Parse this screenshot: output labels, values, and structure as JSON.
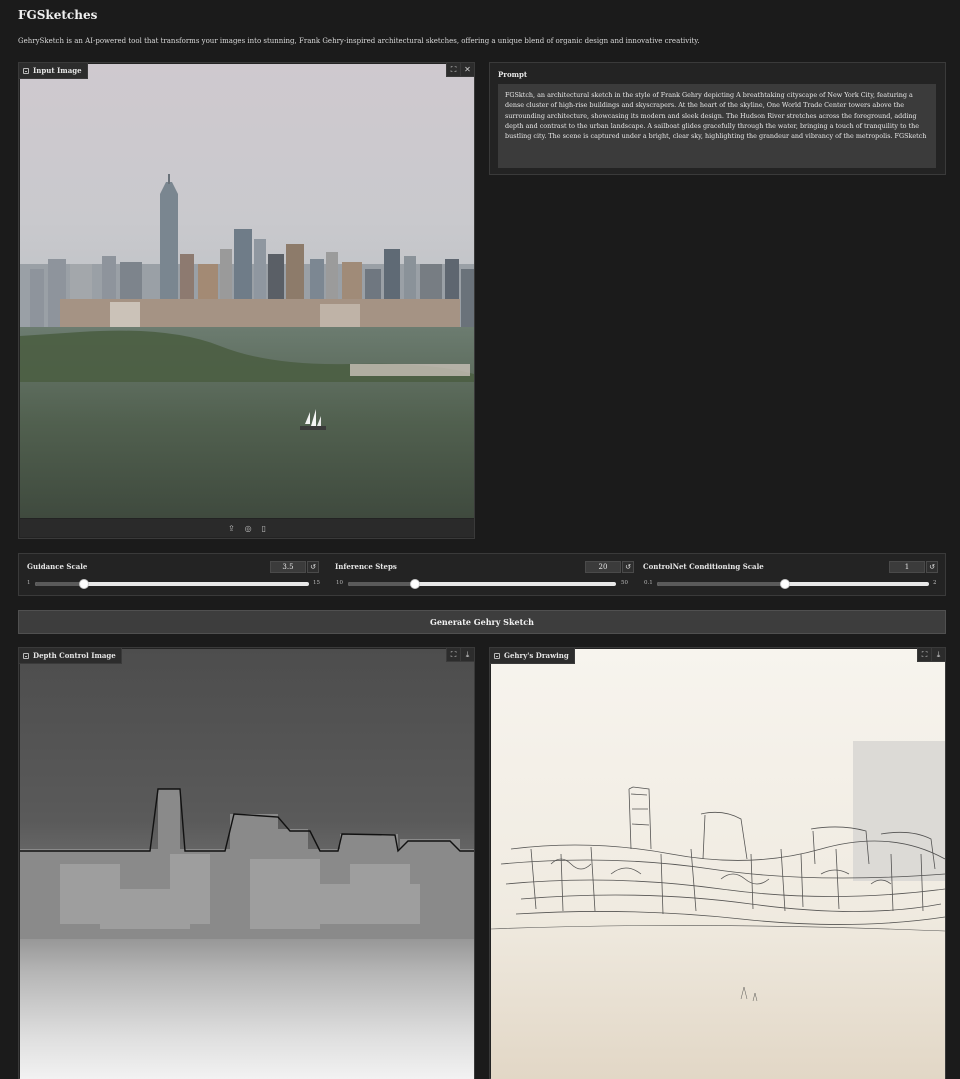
{
  "app": {
    "title": "FGSketches",
    "description": "GehrySketch is an AI-powered tool that transforms your images into stunning, Frank Gehry-inspired architectural sketches, offering a unique blend of organic design and innovative creativity."
  },
  "input_image": {
    "label": "Input Image",
    "icons": [
      "image-icon",
      "fullscreen-icon",
      "close-icon",
      "upload-icon",
      "webcam-icon",
      "clipboard-icon"
    ]
  },
  "prompt": {
    "label": "Prompt",
    "value": "FGSktch, an architectural sketch in the style of Frank Gehry depicting A breathtaking cityscape of New York City, featuring a dense cluster of high-rise buildings and skyscrapers. At the heart of the skyline, One World Trade Center towers above the surrounding architecture, showcasing its modern and sleek design. The Hudson River stretches across the foreground, adding depth and contrast to the urban landscape. A sailboat glides gracefully through the water, bringing a touch of tranquility to the bustling city. The scene is captured under a bright, clear sky, highlighting the grandeur and vibrancy of the metropolis. FGSketch"
  },
  "sliders": [
    {
      "label": "Guidance Scale",
      "value": "3.5",
      "min": "1",
      "max": "15",
      "fraction": 0.18
    },
    {
      "label": "Inference Steps",
      "value": "20",
      "min": "10",
      "max": "50",
      "fraction": 0.25
    },
    {
      "label": "ControlNet Conditioning Scale",
      "value": "1",
      "min": "0.1",
      "max": "2",
      "fraction": 0.47
    }
  ],
  "generate_button": {
    "label": "Generate Gehry Sketch"
  },
  "outputs": {
    "depth": {
      "label": "Depth Control Image"
    },
    "drawing": {
      "label": "Gehry's Drawing"
    }
  },
  "colors": {
    "background": "#1b1b1b",
    "panel": "#232323",
    "button": "#3d3d3d"
  }
}
